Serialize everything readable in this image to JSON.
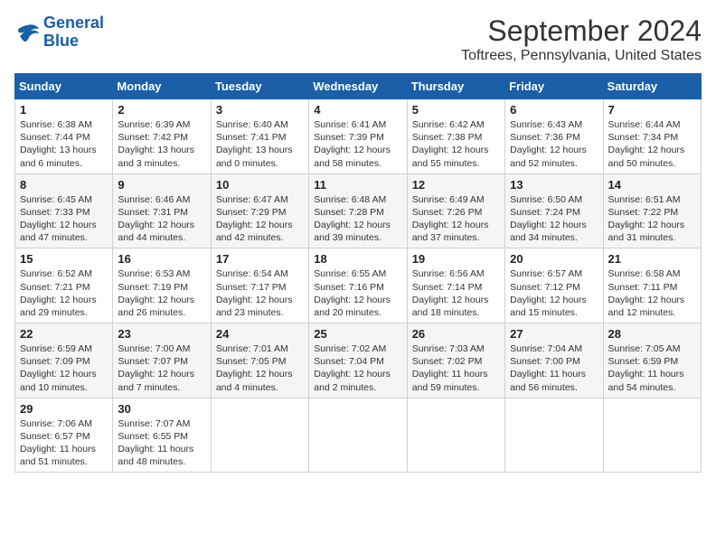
{
  "header": {
    "logo_line1": "General",
    "logo_line2": "Blue",
    "month": "September 2024",
    "location": "Toftrees, Pennsylvania, United States"
  },
  "weekdays": [
    "Sunday",
    "Monday",
    "Tuesday",
    "Wednesday",
    "Thursday",
    "Friday",
    "Saturday"
  ],
  "days": [
    {
      "num": "1",
      "sunrise": "6:38 AM",
      "sunset": "7:44 PM",
      "daylight": "13 hours and 6 minutes."
    },
    {
      "num": "2",
      "sunrise": "6:39 AM",
      "sunset": "7:42 PM",
      "daylight": "13 hours and 3 minutes."
    },
    {
      "num": "3",
      "sunrise": "6:40 AM",
      "sunset": "7:41 PM",
      "daylight": "13 hours and 0 minutes."
    },
    {
      "num": "4",
      "sunrise": "6:41 AM",
      "sunset": "7:39 PM",
      "daylight": "12 hours and 58 minutes."
    },
    {
      "num": "5",
      "sunrise": "6:42 AM",
      "sunset": "7:38 PM",
      "daylight": "12 hours and 55 minutes."
    },
    {
      "num": "6",
      "sunrise": "6:43 AM",
      "sunset": "7:36 PM",
      "daylight": "12 hours and 52 minutes."
    },
    {
      "num": "7",
      "sunrise": "6:44 AM",
      "sunset": "7:34 PM",
      "daylight": "12 hours and 50 minutes."
    },
    {
      "num": "8",
      "sunrise": "6:45 AM",
      "sunset": "7:33 PM",
      "daylight": "12 hours and 47 minutes."
    },
    {
      "num": "9",
      "sunrise": "6:46 AM",
      "sunset": "7:31 PM",
      "daylight": "12 hours and 44 minutes."
    },
    {
      "num": "10",
      "sunrise": "6:47 AM",
      "sunset": "7:29 PM",
      "daylight": "12 hours and 42 minutes."
    },
    {
      "num": "11",
      "sunrise": "6:48 AM",
      "sunset": "7:28 PM",
      "daylight": "12 hours and 39 minutes."
    },
    {
      "num": "12",
      "sunrise": "6:49 AM",
      "sunset": "7:26 PM",
      "daylight": "12 hours and 37 minutes."
    },
    {
      "num": "13",
      "sunrise": "6:50 AM",
      "sunset": "7:24 PM",
      "daylight": "12 hours and 34 minutes."
    },
    {
      "num": "14",
      "sunrise": "6:51 AM",
      "sunset": "7:22 PM",
      "daylight": "12 hours and 31 minutes."
    },
    {
      "num": "15",
      "sunrise": "6:52 AM",
      "sunset": "7:21 PM",
      "daylight": "12 hours and 29 minutes."
    },
    {
      "num": "16",
      "sunrise": "6:53 AM",
      "sunset": "7:19 PM",
      "daylight": "12 hours and 26 minutes."
    },
    {
      "num": "17",
      "sunrise": "6:54 AM",
      "sunset": "7:17 PM",
      "daylight": "12 hours and 23 minutes."
    },
    {
      "num": "18",
      "sunrise": "6:55 AM",
      "sunset": "7:16 PM",
      "daylight": "12 hours and 20 minutes."
    },
    {
      "num": "19",
      "sunrise": "6:56 AM",
      "sunset": "7:14 PM",
      "daylight": "12 hours and 18 minutes."
    },
    {
      "num": "20",
      "sunrise": "6:57 AM",
      "sunset": "7:12 PM",
      "daylight": "12 hours and 15 minutes."
    },
    {
      "num": "21",
      "sunrise": "6:58 AM",
      "sunset": "7:11 PM",
      "daylight": "12 hours and 12 minutes."
    },
    {
      "num": "22",
      "sunrise": "6:59 AM",
      "sunset": "7:09 PM",
      "daylight": "12 hours and 10 minutes."
    },
    {
      "num": "23",
      "sunrise": "7:00 AM",
      "sunset": "7:07 PM",
      "daylight": "12 hours and 7 minutes."
    },
    {
      "num": "24",
      "sunrise": "7:01 AM",
      "sunset": "7:05 PM",
      "daylight": "12 hours and 4 minutes."
    },
    {
      "num": "25",
      "sunrise": "7:02 AM",
      "sunset": "7:04 PM",
      "daylight": "12 hours and 2 minutes."
    },
    {
      "num": "26",
      "sunrise": "7:03 AM",
      "sunset": "7:02 PM",
      "daylight": "11 hours and 59 minutes."
    },
    {
      "num": "27",
      "sunrise": "7:04 AM",
      "sunset": "7:00 PM",
      "daylight": "11 hours and 56 minutes."
    },
    {
      "num": "28",
      "sunrise": "7:05 AM",
      "sunset": "6:59 PM",
      "daylight": "11 hours and 54 minutes."
    },
    {
      "num": "29",
      "sunrise": "7:06 AM",
      "sunset": "6:57 PM",
      "daylight": "11 hours and 51 minutes."
    },
    {
      "num": "30",
      "sunrise": "7:07 AM",
      "sunset": "6:55 PM",
      "daylight": "11 hours and 48 minutes."
    }
  ]
}
